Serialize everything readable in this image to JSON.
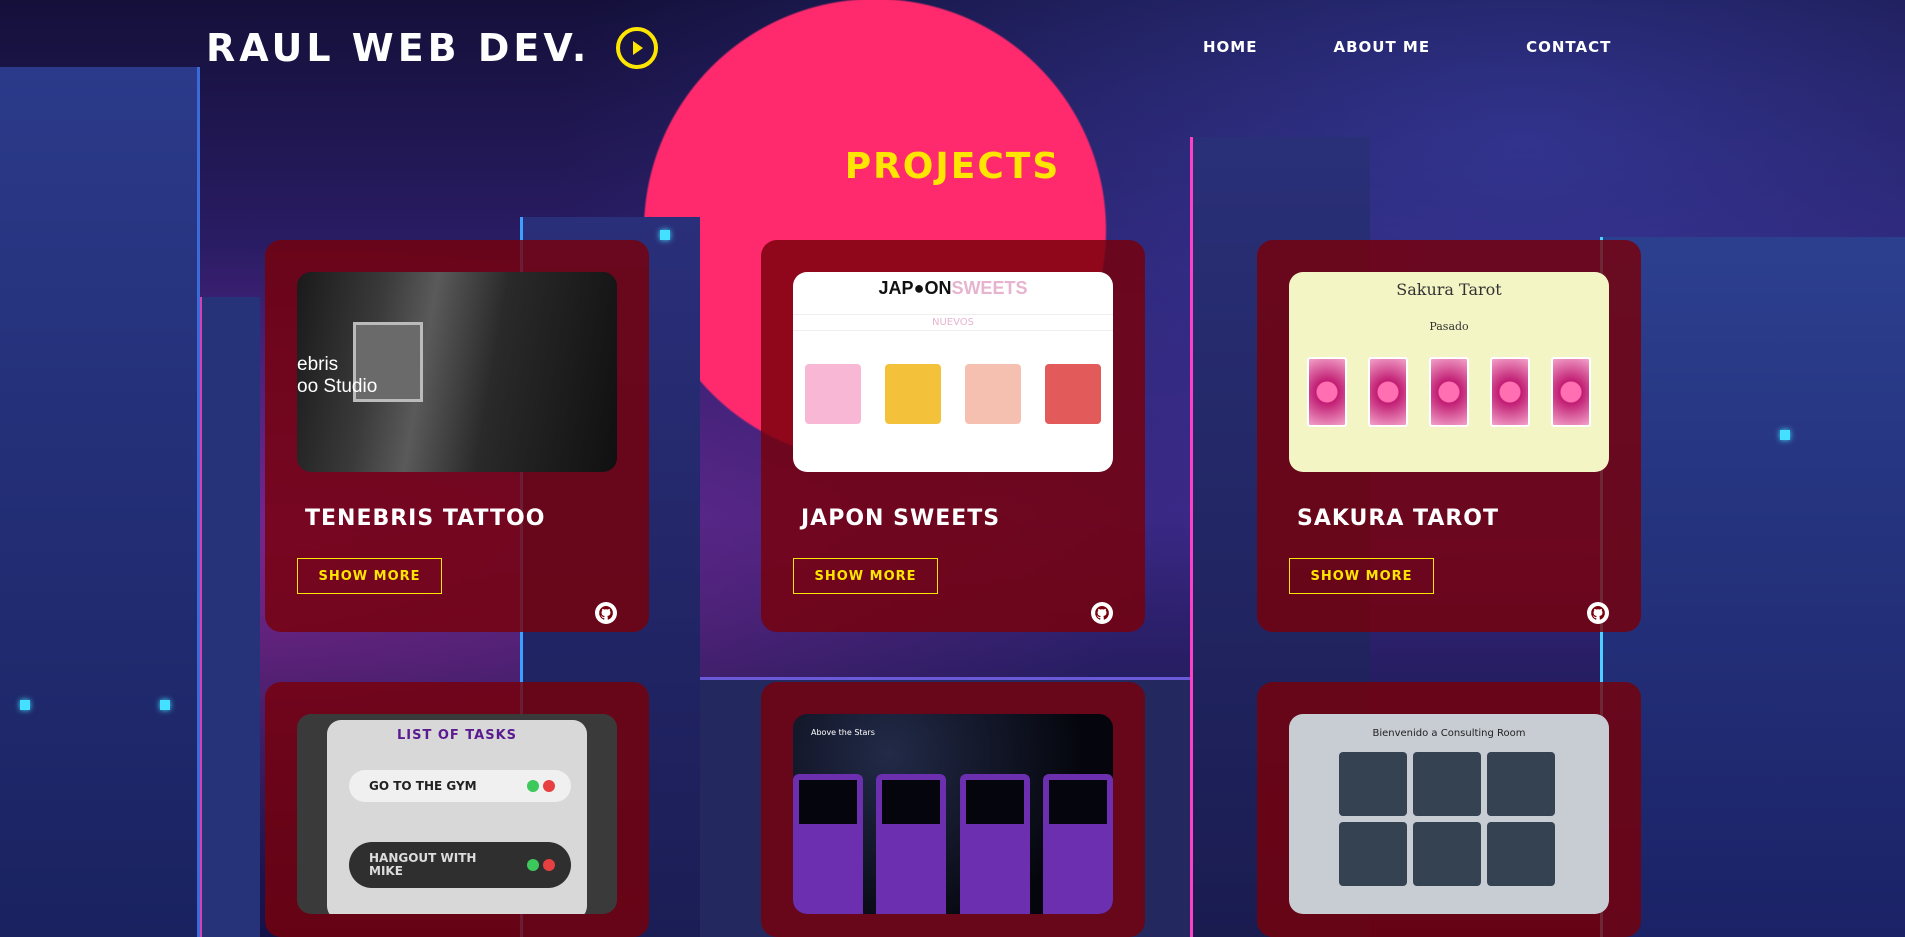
{
  "header": {
    "brand": "RAUL WEB DEV.",
    "nav": [
      "HOME",
      "ABOUT ME",
      "CONTACT"
    ]
  },
  "projects": {
    "title": "PROJECTS",
    "button_label": "SHOW MORE",
    "cards": [
      {
        "name": "TENEBRIS TATTOO",
        "thumb_text": "ebris\noo Studio"
      },
      {
        "name": "JAPON SWEETS",
        "thumb_logo_a": "JAP",
        "thumb_logo_b": "ON",
        "thumb_logo_c": "SWEETS",
        "thumb_sub": "NUEVOS"
      },
      {
        "name": "SAKURA TAROT",
        "thumb_title": "Sakura Tarot",
        "thumb_sub": "Pasado"
      },
      {
        "name": "",
        "thumb_title": "LIST OF TASKS",
        "tasks": [
          "GO TO THE GYM",
          "HANGOUT WITH MIKE"
        ]
      },
      {
        "name": "",
        "thumb_title": "Above the Stars"
      },
      {
        "name": "",
        "thumb_title": "Bienvenido a Consulting Room"
      }
    ]
  },
  "colors": {
    "accent": "#ffe600",
    "card": "#78000a",
    "moon": "#ff2a6d"
  },
  "icons": [
    "play-icon",
    "github-icon"
  ]
}
